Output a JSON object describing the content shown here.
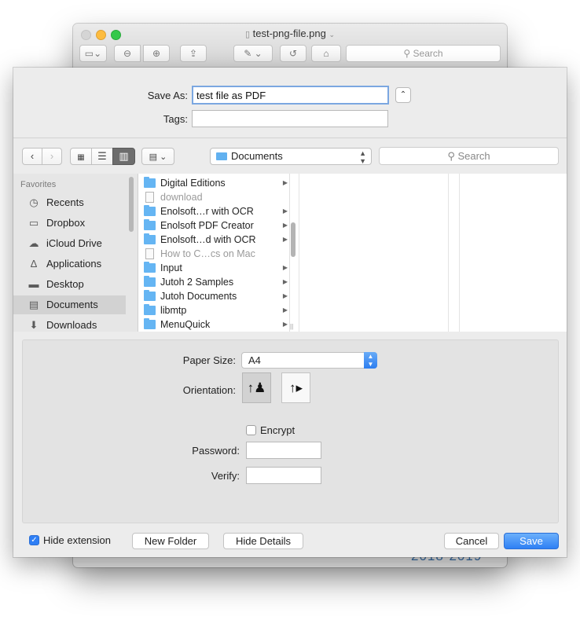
{
  "background_window": {
    "title": "test-png-file.png",
    "search_placeholder": "Search",
    "footer_text": "2018-2019"
  },
  "sheet": {
    "save_as_label": "Save As:",
    "save_as_value": "test file as PDF",
    "tags_label": "Tags:",
    "tags_value": "",
    "location": "Documents",
    "search_placeholder": "Search"
  },
  "sidebar": {
    "heading": "Favorites",
    "items": [
      {
        "label": "Recents",
        "icon": "clock-icon",
        "glyph": "◷"
      },
      {
        "label": "Dropbox",
        "icon": "folder-icon",
        "glyph": "▭"
      },
      {
        "label": "iCloud Drive",
        "icon": "cloud-icon",
        "glyph": "☁"
      },
      {
        "label": "Applications",
        "icon": "applications-icon",
        "glyph": "∆"
      },
      {
        "label": "Desktop",
        "icon": "desktop-icon",
        "glyph": "▬"
      },
      {
        "label": "Documents",
        "icon": "documents-icon",
        "glyph": "▤",
        "selected": true
      },
      {
        "label": "Downloads",
        "icon": "downloads-icon",
        "glyph": "⬇"
      }
    ]
  },
  "files": [
    {
      "name": "Digital Editions",
      "type": "folder",
      "dim": false
    },
    {
      "name": "download",
      "type": "doc",
      "dim": true
    },
    {
      "name": "Enolsoft…r with OCR",
      "type": "folder",
      "dim": false
    },
    {
      "name": "Enolsoft PDF Creator",
      "type": "folder",
      "dim": false
    },
    {
      "name": "Enolsoft…d with OCR",
      "type": "folder",
      "dim": false
    },
    {
      "name": "How to C…cs on Mac",
      "type": "doc",
      "dim": true
    },
    {
      "name": "Input",
      "type": "folder",
      "dim": false
    },
    {
      "name": "Jutoh 2 Samples",
      "type": "folder",
      "dim": false
    },
    {
      "name": "Jutoh Documents",
      "type": "folder",
      "dim": false
    },
    {
      "name": "libmtp",
      "type": "folder",
      "dim": false
    },
    {
      "name": "MenuQuick",
      "type": "folder",
      "dim": false
    }
  ],
  "options": {
    "paper_size_label": "Paper Size:",
    "paper_size_value": "A4",
    "orientation_label": "Orientation:",
    "encrypt_label": "Encrypt",
    "encrypt_checked": false,
    "password_label": "Password:",
    "verify_label": "Verify:"
  },
  "footer": {
    "hide_extension_label": "Hide extension",
    "hide_extension_checked": true,
    "new_folder": "New Folder",
    "hide_details": "Hide Details",
    "cancel": "Cancel",
    "save": "Save"
  },
  "colors": {
    "accent": "#2f80f4",
    "folder": "#65b5f3",
    "selection_gray": "#d2d2d2"
  }
}
